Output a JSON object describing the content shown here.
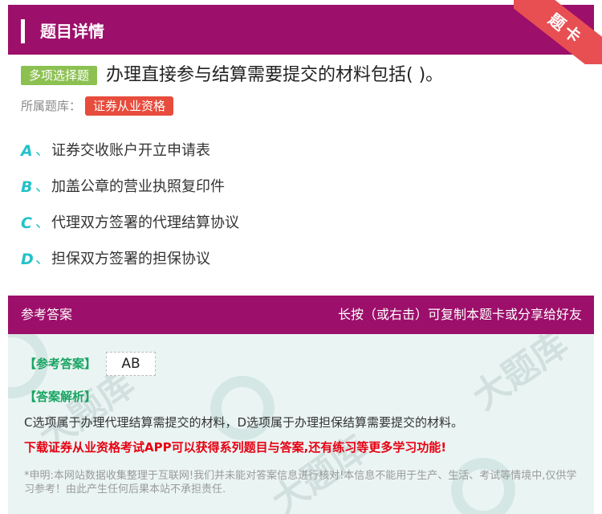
{
  "header": {
    "title": "题目详情",
    "ribbon": "题卡"
  },
  "question": {
    "type_badge": "多项选择题",
    "text": "办理直接参与结算需要提交的材料包括( )。",
    "bank_label": "所属题库：",
    "bank_tag": "证券从业资格"
  },
  "options": [
    {
      "letter": "A",
      "sep": "、",
      "text": "证券交收账户开立申请表"
    },
    {
      "letter": "B",
      "sep": "、",
      "text": "加盖公章的营业执照复印件"
    },
    {
      "letter": "C",
      "sep": "、",
      "text": "代理双方签署的代理结算协议"
    },
    {
      "letter": "D",
      "sep": "、",
      "text": "担保双方签署的担保协议"
    }
  ],
  "answer_section": {
    "title": "参考答案",
    "hint": "长按（或右击）可复制本题卡或分享给好友",
    "ref_label": "【参考答案】",
    "ref_value": "AB",
    "analysis_label": "【答案解析】",
    "analysis_text": "C选项属于办理代理结算需提交的材料，D选项属于办理担保结算需要提交的材料。",
    "promo_text": "下载证券从业资格考试APP可以获得系列题目与答案,还有练习等更多学习功能!",
    "disclaimer": "*申明:本网站数据收集整理于互联网!我们并未能对答案信息进行核对!本信息不能用于生产、生活、考试等情境中,仅供学习参考！由此产生任何后果本站不承担责任."
  },
  "colors": {
    "header_bg": "#9c0f6a",
    "badge_green": "#8cc152",
    "tag_red": "#e74c3c",
    "option_letter": "#23c2c9",
    "answer_green": "#19a463",
    "promo_red": "#e60012",
    "answer_bg": "#eaf5f3"
  }
}
